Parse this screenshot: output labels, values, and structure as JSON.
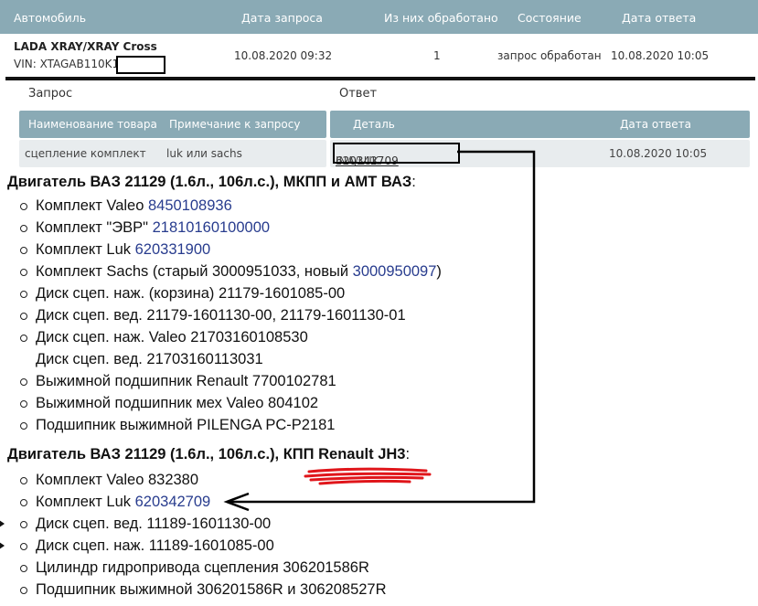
{
  "top_table": {
    "headers": [
      "Автомобиль",
      "Дата запроса",
      "Из них обработано",
      "Состояние",
      "Дата ответа"
    ],
    "row": {
      "car": "LADA XRAY/XRAY Cross",
      "vin_label": "VIN: XTAGAB110K1",
      "request_date": "10.08.2020 09:32",
      "processed": "1",
      "status": "запрос обработан",
      "answer_date": "10.08.2020 10:05"
    }
  },
  "request_section": {
    "label": "Запрос",
    "headers": [
      "Наименование товара",
      "Примечание к запросу"
    ],
    "row": {
      "item": "сцепление комплект",
      "note": "luk или sachs"
    }
  },
  "answer_section": {
    "label": "Ответ",
    "headers": [
      "Деталь",
      "Дата ответа"
    ],
    "row": {
      "part_number": "620342709",
      "part_brand": "INA/LUK",
      "date": "10.08.2020 10:05"
    }
  },
  "engine1": {
    "title": "Двигатель ВАЗ 21129 (1.6л., 106л.с.), МКПП и АМТ ВАЗ",
    "colon": ":",
    "items": [
      {
        "text": "Комплект Valeo ",
        "link": "8450108936"
      },
      {
        "text": "Комплект \"ЭВР\" ",
        "link": "21810160100000"
      },
      {
        "text": "Комплект Luk ",
        "link": "620331900"
      },
      {
        "text": "Комплект Sachs (старый 3000951033, новый ",
        "link": "3000950097",
        "suffix": ")"
      },
      {
        "text": "Диск сцеп. наж. (корзина) 21179-1601085-00"
      },
      {
        "text": "Диск сцеп. вед. 21179-1601130-00, 21179-1601130-01"
      },
      {
        "text": "Диск сцеп. наж. Valeo 21703160108530"
      },
      {
        "text": "Диск сцеп. вед. 21703160113031",
        "nobullet": true
      },
      {
        "text": "Выжимной подшипник Renault 7700102781"
      },
      {
        "text": "Выжимной подшипник мех Valeo 804102"
      },
      {
        "text": "Подшипник выжимной PILENGA PC-P2181"
      }
    ]
  },
  "engine2": {
    "title": "Двигатель ВАЗ 21129 (1.6л., 106л.с.), КПП Renault JH3",
    "colon": ":",
    "items": [
      {
        "text": "Комплект Valeo 832380"
      },
      {
        "text": "Комплект Luk ",
        "link": "620342709"
      },
      {
        "text": "Диск сцеп. вед. 11189-1601130-00",
        "side": true
      },
      {
        "text": "Диск сцеп. наж. 11189-1601085-00",
        "side": true
      },
      {
        "text": "Цилиндр гидропривода сцепления 306201586R"
      },
      {
        "text": "Подшипник выжимной 306201586R и 306208527R"
      }
    ]
  },
  "colors": {
    "header_bg": "#8aaab5",
    "row_bg": "#e8ecee",
    "link": "#283c8e",
    "scribble": "#e0161b"
  }
}
